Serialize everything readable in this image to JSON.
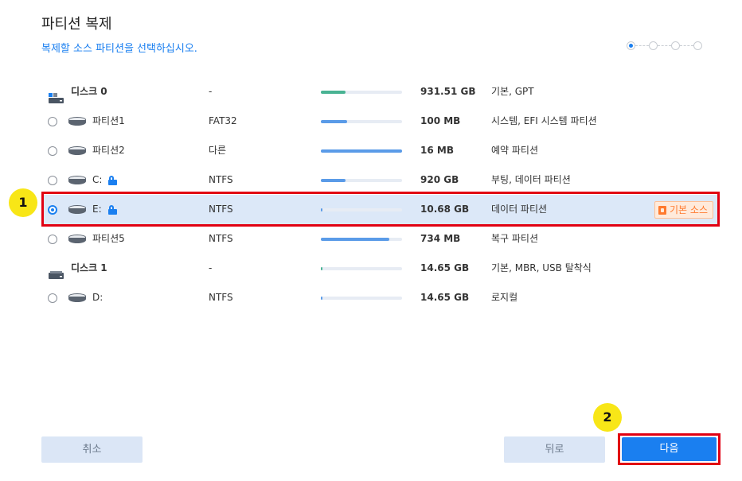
{
  "header": {
    "title": "파티션 복제",
    "subtitle": "복제할 소스 파티션을 선택하십시오."
  },
  "steps": {
    "total": 4,
    "current": 1
  },
  "rows": [
    {
      "type": "disk",
      "name": "디스크 0",
      "fs": "-",
      "usage": 0.3,
      "size": "931.51 GB",
      "desc": "기본, GPT"
    },
    {
      "type": "partition",
      "name": "파티션1",
      "fs": "FAT32",
      "usage": 0.32,
      "size": "100 MB",
      "desc": "시스템, EFI 시스템 파티션",
      "selected": false
    },
    {
      "type": "partition",
      "name": "파티션2",
      "fs": "다른",
      "usage": 1.0,
      "size": "16 MB",
      "desc": "예약 파티션",
      "selected": false
    },
    {
      "type": "partition",
      "name": "C:",
      "fs": "NTFS",
      "usage": 0.3,
      "size": "920 GB",
      "desc": "부팅, 데이터 파티션",
      "locked": true,
      "selected": false
    },
    {
      "type": "partition",
      "name": "E:",
      "fs": "NTFS",
      "usage": 0.02,
      "size": "10.68 GB",
      "desc": "데이터 파티션",
      "locked": true,
      "selected": true,
      "badge": "기본 소스"
    },
    {
      "type": "partition",
      "name": "파티션5",
      "fs": "NTFS",
      "usage": 0.84,
      "size": "734 MB",
      "desc": "복구 파티션",
      "selected": false
    },
    {
      "type": "disk",
      "name": "디스크 1",
      "fs": "-",
      "usage": 0.01,
      "size": "14.65 GB",
      "desc": "기본, MBR, USB 탈착식",
      "removable": true
    },
    {
      "type": "partition",
      "name": "D:",
      "fs": "NTFS",
      "usage": 0.01,
      "size": "14.65 GB",
      "desc": "로지컬",
      "selected": false
    }
  ],
  "markers": {
    "first": "1",
    "second": "2"
  },
  "buttons": {
    "cancel": "취소",
    "back": "뒤로",
    "next": "다음"
  },
  "colors": {
    "accent": "#1a7ff0",
    "highlight": "#e10012",
    "marker": "#f8e617",
    "badge": "#ff7a2f"
  }
}
